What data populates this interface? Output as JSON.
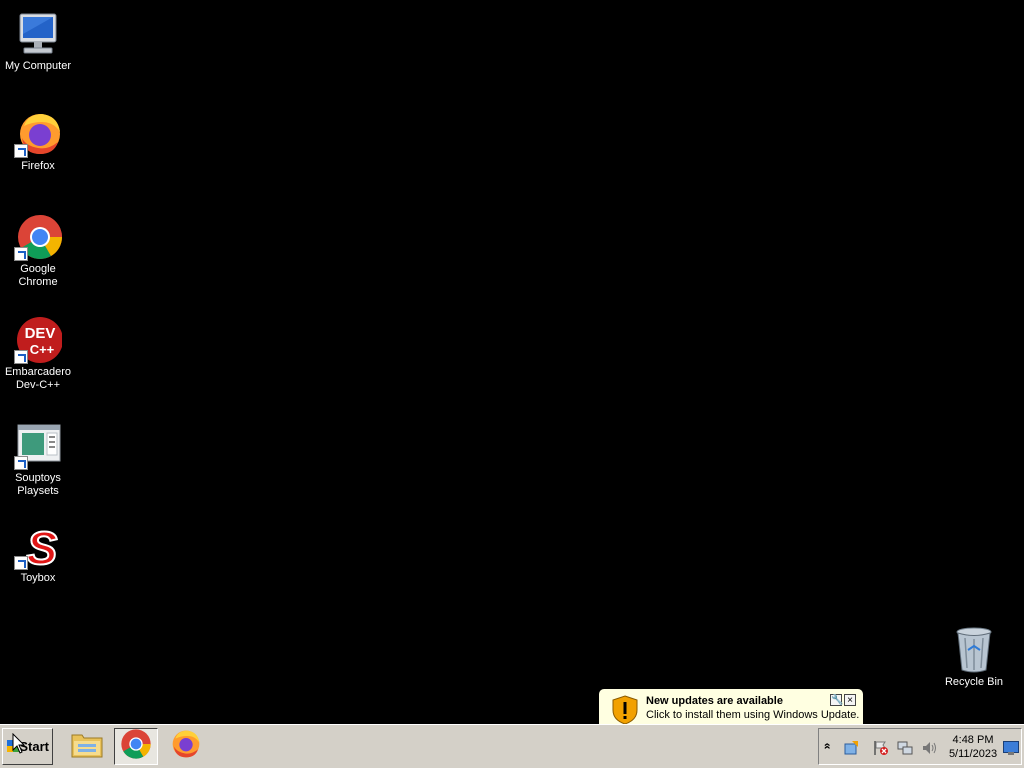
{
  "desktop": {
    "icons": [
      {
        "label": "My Computer",
        "icon": "computer-icon"
      },
      {
        "label": "Firefox",
        "icon": "firefox-icon"
      },
      {
        "label": "Google Chrome",
        "icon": "chrome-icon"
      },
      {
        "label": "Embarcadero Dev-C++",
        "line1": "Embarcadero",
        "line2": "Dev-C++",
        "icon_text_top": "DEV",
        "icon_text_bottom": "C++",
        "icon": "devcpp-icon"
      },
      {
        "label": "Souptoys Playsets",
        "line1": "Souptoys",
        "line2": "Playsets",
        "icon": "souptoys-icon"
      },
      {
        "label": "Toybox",
        "icon_text": "S",
        "icon": "toybox-icon"
      },
      {
        "label": "Recycle Bin",
        "icon": "recycle-bin-icon"
      }
    ]
  },
  "taskbar": {
    "start_label": "Start",
    "pinned": [
      {
        "name": "File Explorer",
        "icon": "folder-icon"
      },
      {
        "name": "Google Chrome",
        "icon": "chrome-icon",
        "active": true
      },
      {
        "name": "Firefox",
        "icon": "firefox-icon"
      }
    ],
    "tray": {
      "chevron": "»",
      "time": "4:48 PM",
      "date": "5/11/2023"
    }
  },
  "notification": {
    "title": "New updates are available",
    "text": "Click to install them using Windows Update.",
    "settings_symbol": "🔧",
    "close_symbol": "×"
  },
  "colors": {
    "desktop_bg": "#000000",
    "taskbar_bg": "#d4d0c8",
    "balloon_bg": "#ffffe1"
  }
}
